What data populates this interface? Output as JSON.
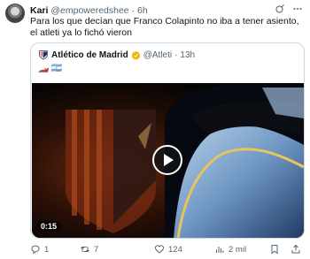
{
  "author": {
    "name": "Kari",
    "handle": "@empoweredshee",
    "separator": "·",
    "time": "6h"
  },
  "tweet": {
    "text": "Para los que decían que Franco Colapinto no iba a tener asiento, el atleti ya lo fichó vieron"
  },
  "quoted": {
    "name": "Atlético de Madrid",
    "handle": "@Atleti",
    "separator": "·",
    "time": "13h",
    "emoji_1": "🏎️",
    "emoji_2": "🇦🇷",
    "video_duration": "0:15"
  },
  "actions": {
    "replies": "1",
    "retweets": "7",
    "likes": "124",
    "views": "2 mil"
  },
  "icons": [
    "grok-icon",
    "more-icon",
    "club-crest-icon",
    "verified-badge-icon",
    "play-icon",
    "reply-icon",
    "retweet-icon",
    "like-icon",
    "views-icon",
    "bookmark-icon",
    "share-icon"
  ],
  "colors": {
    "text": "#0f1419",
    "muted": "#536471",
    "verified": "#f5b400",
    "border": "#cfd9de"
  }
}
